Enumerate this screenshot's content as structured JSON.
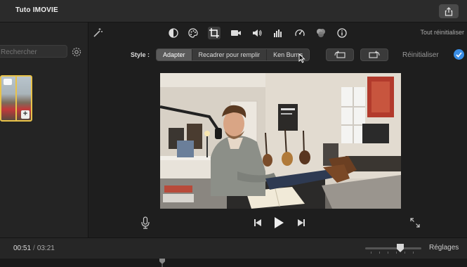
{
  "window": {
    "title": "Tuto IMOVIE"
  },
  "sidebar": {
    "search_placeholder": "Rechercher"
  },
  "toolbar": {
    "icons": [
      "magic-wand-icon",
      "color-balance-icon",
      "color-palette-icon",
      "crop-icon",
      "stabilization-camera-icon",
      "volume-icon",
      "equalizer-icon",
      "speed-icon",
      "filter-icon",
      "info-icon"
    ],
    "reset_all_label": "Tout réinitialiser"
  },
  "crop": {
    "style_label": "Style :",
    "options": [
      "Adapter",
      "Recadrer pour remplir",
      "Ken Burns"
    ],
    "selected": "Adapter",
    "reset_label": "Réinitialiser"
  },
  "playback": {
    "current_time": "00:51",
    "separator": "/",
    "total_time": "03:21"
  },
  "zoom": {
    "label": "Réglages",
    "level": 0.62
  },
  "colors": {
    "accent": "#3a8ee6",
    "selection": "#e8c24a"
  }
}
